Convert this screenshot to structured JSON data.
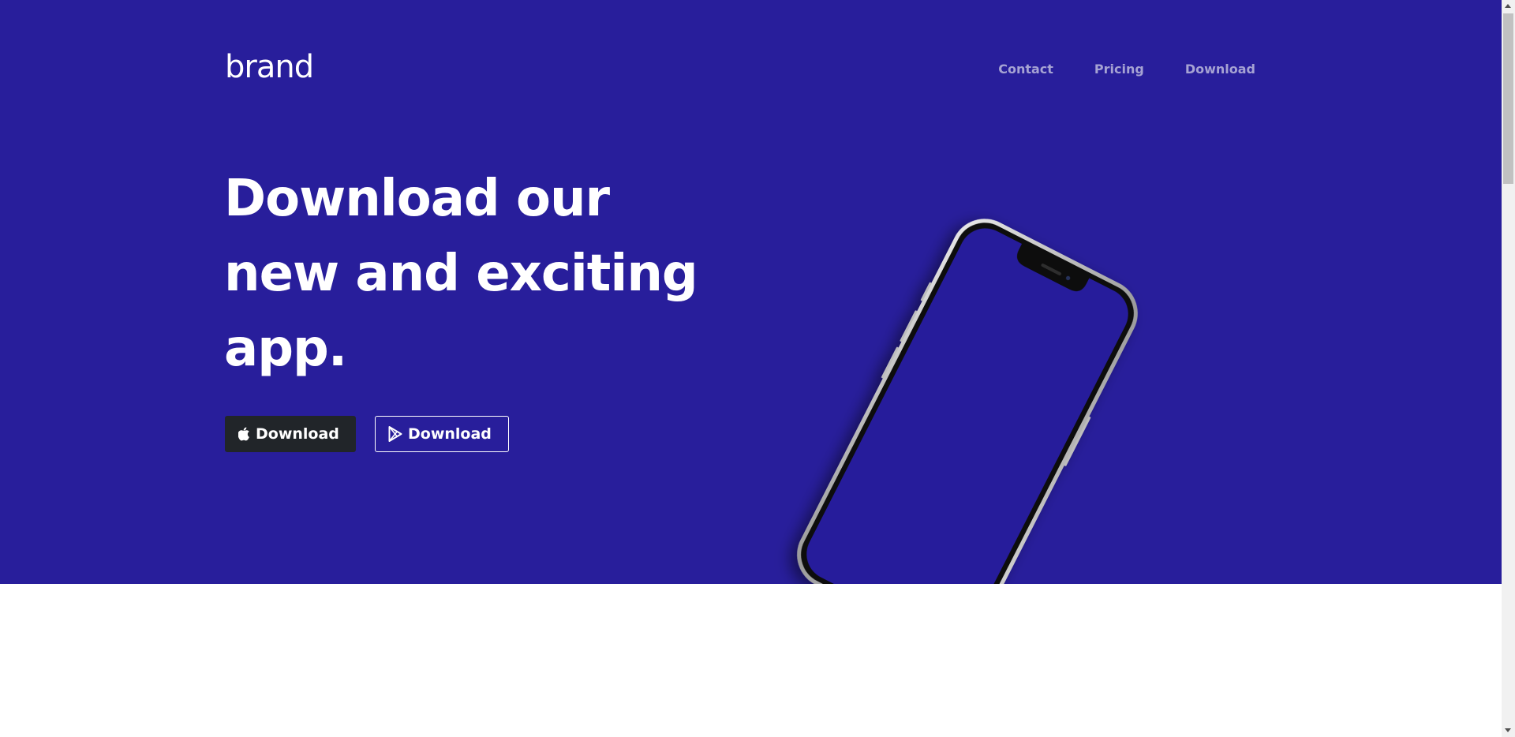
{
  "colors": {
    "hero_background": "#281e9b",
    "nav_link": "#a6a3d3",
    "ios_button_background": "#212529",
    "text_light": "#ffffff"
  },
  "header": {
    "brand": "brand",
    "nav": [
      {
        "label": "Contact"
      },
      {
        "label": "Pricing"
      },
      {
        "label": "Download"
      }
    ]
  },
  "hero": {
    "headline": "Download our new and exciting app.",
    "buttons": {
      "ios": {
        "label": "Download",
        "icon": "apple-icon"
      },
      "android": {
        "label": "Download",
        "icon": "google-play-icon"
      }
    },
    "image": {
      "icon": "smartphone-mockup"
    }
  }
}
